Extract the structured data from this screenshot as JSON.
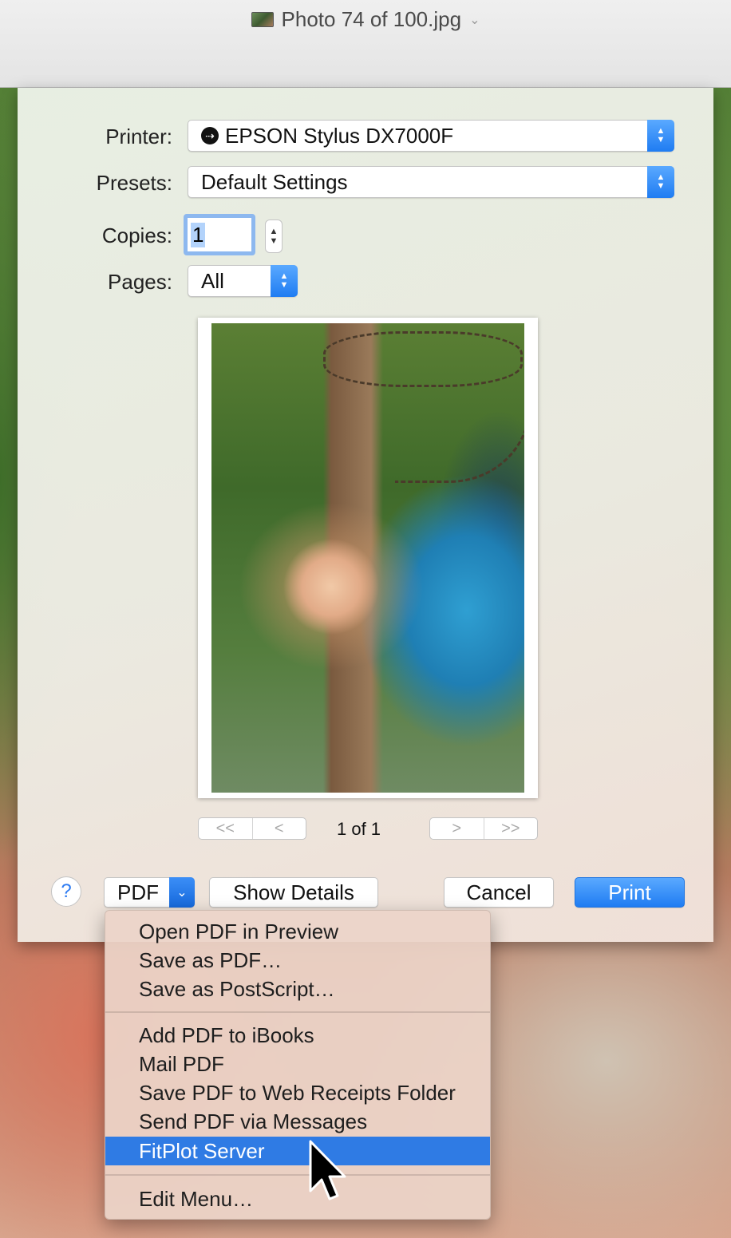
{
  "window": {
    "title": "Photo 74 of 100.jpg",
    "title_chevron": "⌄"
  },
  "form": {
    "printer_label": "Printer:",
    "printer_value": "EPSON Stylus DX7000F",
    "presets_label": "Presets:",
    "presets_value": "Default Settings",
    "copies_label": "Copies:",
    "copies_value": "1",
    "pages_label": "Pages:",
    "pages_value": "All"
  },
  "page_nav": {
    "first": "<<",
    "prev": "<",
    "indicator": "1 of 1",
    "next": ">",
    "last": ">>"
  },
  "buttons": {
    "help": "?",
    "pdf": "PDF",
    "show_details": "Show Details",
    "cancel": "Cancel",
    "print": "Print"
  },
  "pdf_menu": {
    "items": [
      {
        "label": "Open PDF in Preview"
      },
      {
        "label": "Save as PDF…"
      },
      {
        "label": "Save as PostScript…"
      },
      {
        "label": "Add PDF to iBooks"
      },
      {
        "label": "Mail PDF"
      },
      {
        "label": "Save PDF to Web Receipts Folder"
      },
      {
        "label": "Send PDF via Messages"
      },
      {
        "label": "FitPlot Server",
        "selected": true
      },
      {
        "label": "Edit Menu…"
      }
    ]
  },
  "colors": {
    "accent": "#2f7be4",
    "menu_bg": "#ecd4c8"
  }
}
